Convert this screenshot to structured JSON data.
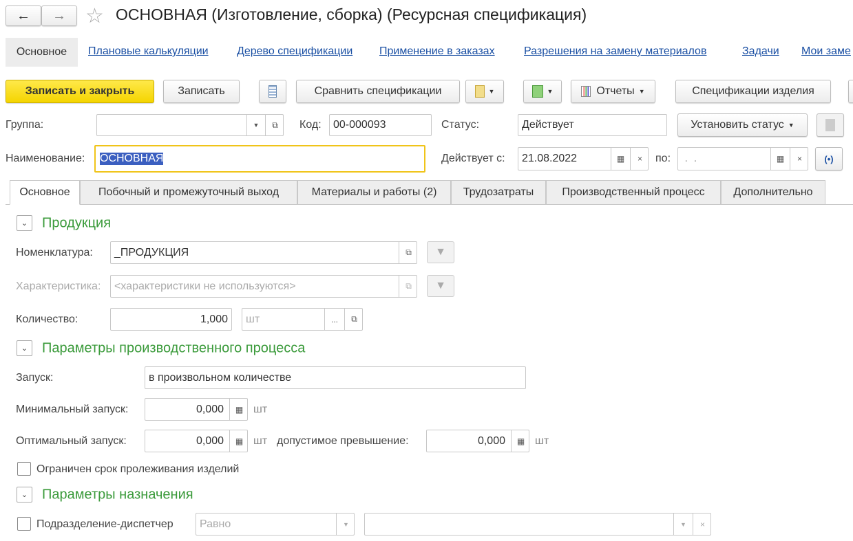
{
  "window": {
    "title": "ОСНОВНАЯ (Изготовление, сборка) (Ресурсная спецификация)"
  },
  "nav": {
    "items": [
      "Основное",
      "Плановые калькуляции",
      "Дерево спецификации",
      "Применение в заказах",
      "Разрешения на замену материалов",
      "Задачи",
      "Мои заме"
    ]
  },
  "toolbar": {
    "save_close": "Записать и закрыть",
    "save": "Записать",
    "compare": "Сравнить спецификации",
    "reports": "Отчеты",
    "product_specs": "Спецификации изделия"
  },
  "header_fields": {
    "group_label": "Группа:",
    "group_value": "",
    "code_label": "Код:",
    "code_value": "00-000093",
    "status_label": "Статус:",
    "status_value": "Действует",
    "set_status": "Установить статус",
    "name_label": "Наименование:",
    "name_value": "ОСНОВНАЯ",
    "valid_from_label": "Действует с:",
    "valid_from_value": "21.08.2022",
    "valid_to_label": "по:",
    "valid_to_value": " .  ."
  },
  "tabs": [
    "Основное",
    "Побочный и промежуточный выход",
    "Материалы и работы (2)",
    "Трудозатраты",
    "Производственный процесс",
    "Дополнительно"
  ],
  "product": {
    "title": "Продукция",
    "nom_label": "Номенклатура:",
    "nom_value": "_ПРОДУКЦИЯ",
    "char_label": "Характеристика:",
    "char_placeholder": "<характеристики не используются>",
    "qty_label": "Количество:",
    "qty_value": "1,000",
    "unit_value": "шт",
    "ellipsis": "..."
  },
  "process": {
    "title": "Параметры производственного процесса",
    "launch_label": "Запуск:",
    "launch_value": "в произвольном количестве",
    "min_label": "Минимальный запуск:",
    "min_value": "0,000",
    "unit": "шт",
    "opt_label": "Оптимальный запуск:",
    "opt_value": "0,000",
    "excess_label": "допустимое превышение:",
    "excess_value": "0,000",
    "shelf_label": "Ограничен срок пролеживания изделий"
  },
  "assign": {
    "title": "Параметры назначения",
    "dispatcher_label": "Подразделение-диспетчер",
    "condition_value": "Равно",
    "dispatcher_value": ""
  },
  "colors": {
    "accent_yellow": "#f4d400",
    "section_green": "#3a9a3a",
    "link_blue": "#1a4fa3",
    "selection": "#3b5fc0"
  }
}
